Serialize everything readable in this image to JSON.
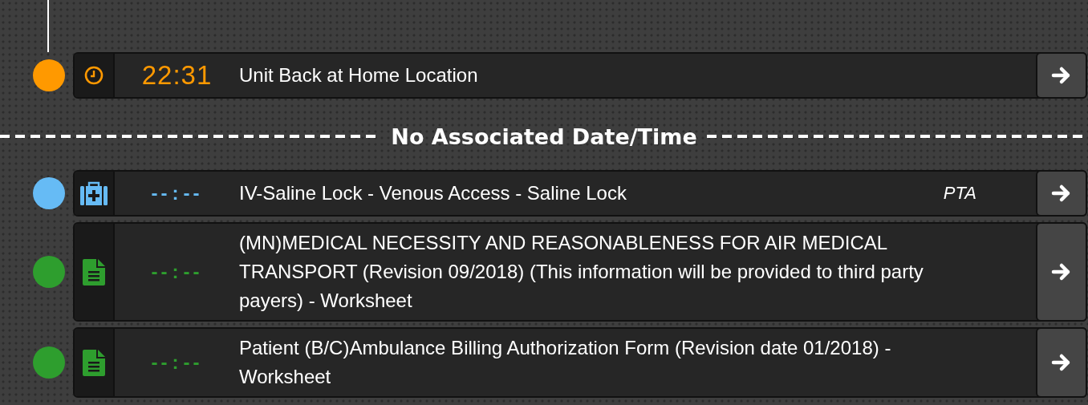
{
  "timed_events": [
    {
      "kind": "clock",
      "color": "#ff9900",
      "time": "22:31",
      "description": "Unit Back at Home Location"
    }
  ],
  "separator": {
    "label": "No Associated Date/Time"
  },
  "untimed_events": [
    {
      "kind": "medkit",
      "color": "#66bbf5",
      "time": "--:--",
      "description": "IV-Saline Lock - Venous Access - Saline Lock",
      "note": "PTA"
    },
    {
      "kind": "document",
      "color": "#2e9e2e",
      "time": "--:--",
      "description": "(MN)MEDICAL NECESSITY AND REASONABLENESS FOR AIR MEDICAL TRANSPORT (Revision 09/2018) (This information will be provided to third party payers) - Worksheet"
    },
    {
      "kind": "document",
      "color": "#2e9e2e",
      "time": "--:--",
      "description": "Patient (B/C)Ambulance Billing Authorization Form (Revision date 01/2018) - Worksheet"
    }
  ]
}
